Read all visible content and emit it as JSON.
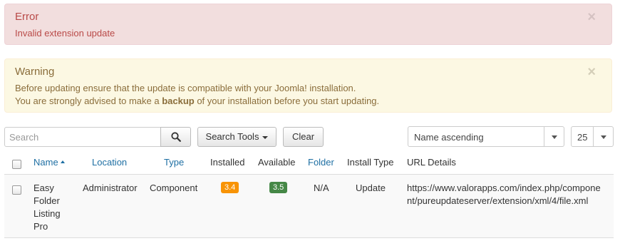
{
  "alerts": {
    "error": {
      "title": "Error",
      "message": "Invalid extension update",
      "close": "×"
    },
    "warning": {
      "title": "Warning",
      "line1": "Before updating ensure that the update is compatible with your Joomla! installation.",
      "line2_pre": "You are strongly advised to make a ",
      "line2_strong": "backup",
      "line2_post": " of your installation before you start updating.",
      "close": "×"
    }
  },
  "toolbar": {
    "search_placeholder": "Search",
    "search_tools_label": "Search Tools",
    "clear_label": "Clear",
    "sort_value": "Name ascending",
    "limit_value": "25"
  },
  "table": {
    "headers": {
      "name": "Name",
      "location": "Location",
      "type": "Type",
      "installed": "Installed",
      "available": "Available",
      "folder": "Folder",
      "install_type": "Install Type",
      "url_details": "URL Details"
    },
    "rows": [
      {
        "name_lines": [
          "Easy",
          "Folder",
          "Listing",
          "Pro"
        ],
        "location": "Administrator",
        "type": "Component",
        "installed": "3.4",
        "available": "3.5",
        "folder": "N/A",
        "install_type": "Update",
        "url_line1": "https://www.valorapps.com/index.php/compone",
        "url_line2": "nt/pureupdateserver/extension/xml/4/file.xml"
      }
    ]
  },
  "colors": {
    "installed_badge": "#f89406",
    "available_badge": "#468847",
    "link": "#1e6fa3"
  }
}
